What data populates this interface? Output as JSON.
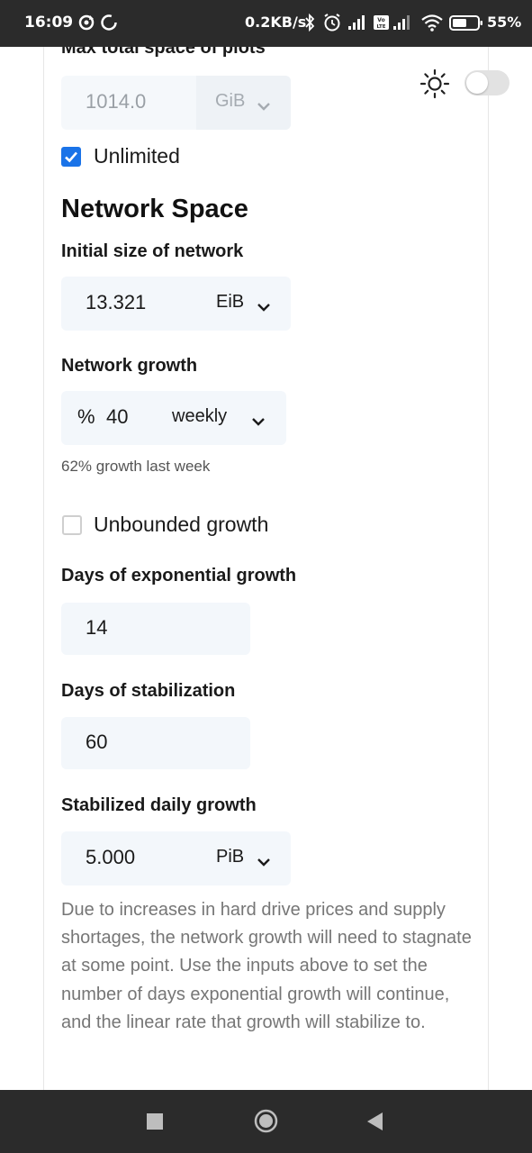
{
  "status_bar": {
    "time": "16:09",
    "network_speed": "0.2KB/s",
    "battery_percent": "55%",
    "icons": [
      "sync-icon",
      "loading-icon",
      "bluetooth-icon",
      "alarm-icon",
      "signal-icon",
      "volte-icon",
      "signal-icon",
      "wifi-icon",
      "battery-icon"
    ]
  },
  "theme": {
    "icon": "sun-icon",
    "toggle_on": false
  },
  "max_plots": {
    "label": "Max total space of plots",
    "value": "1014.0",
    "unit": "GiB"
  },
  "unlimited": {
    "label": "Unlimited",
    "checked": true
  },
  "section_title": "Network Space",
  "initial_size": {
    "label": "Initial size of network",
    "value": "13.321",
    "unit": "EiB"
  },
  "network_growth": {
    "label": "Network growth",
    "prefix": "%",
    "value": "40",
    "period": "weekly",
    "hint": "62% growth last week"
  },
  "unbounded": {
    "label": "Unbounded growth",
    "checked": false
  },
  "exp_days": {
    "label": "Days of exponential growth",
    "value": "14"
  },
  "stab_days": {
    "label": "Days of stabilization",
    "value": "60"
  },
  "stab_growth": {
    "label": "Stabilized daily growth",
    "value": "5.000",
    "unit": "PiB"
  },
  "note": "Due to increases in hard drive prices and supply shortages, the network growth will need to stagnate at some point. Use the inputs above to set the number of days exponential growth will continue, and the linear rate that growth will stabilize to.",
  "nav": {
    "icons": [
      "recents-square-icon",
      "home-circle-icon",
      "back-triangle-icon"
    ]
  },
  "colors": {
    "accent": "#1a73e8",
    "field_bg": "#f3f7fb",
    "system_bar": "#2b2b2b"
  }
}
